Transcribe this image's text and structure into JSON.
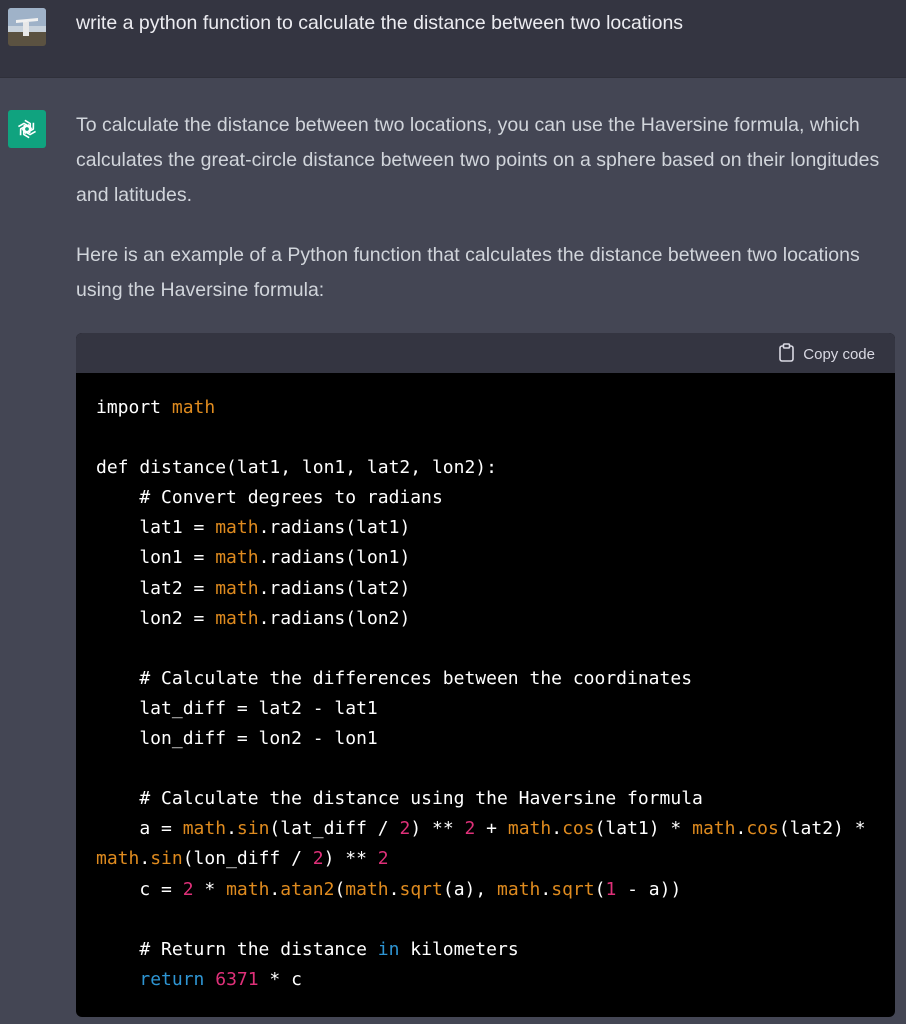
{
  "user_message": "write a python function to calculate the distance between two locations",
  "assistant": {
    "paragraph1": "To calculate the distance between two locations, you can use the Haversine formula, which calculates the great-circle distance between two points on a sphere based on their longitudes and latitudes.",
    "paragraph2": "Here is an example of a Python function that calculates the distance between two locations using the Haversine formula:"
  },
  "code_block": {
    "copy_label": "Copy code",
    "lines": [
      [
        [
          "plain",
          "import "
        ],
        [
          "math",
          "math"
        ]
      ],
      [],
      [
        [
          "plain",
          "def distance(lat1, lon1, lat2, lon2):"
        ]
      ],
      [
        [
          "plain",
          "    # Convert degrees to radians"
        ]
      ],
      [
        [
          "plain",
          "    lat1 = "
        ],
        [
          "math",
          "math"
        ],
        [
          "plain",
          ".radians(lat1)"
        ]
      ],
      [
        [
          "plain",
          "    lon1 = "
        ],
        [
          "math",
          "math"
        ],
        [
          "plain",
          ".radians(lon1)"
        ]
      ],
      [
        [
          "plain",
          "    lat2 = "
        ],
        [
          "math",
          "math"
        ],
        [
          "plain",
          ".radians(lat2)"
        ]
      ],
      [
        [
          "plain",
          "    lon2 = "
        ],
        [
          "math",
          "math"
        ],
        [
          "plain",
          ".radians(lon2)"
        ]
      ],
      [],
      [
        [
          "plain",
          "    # Calculate the differences between the coordinates"
        ]
      ],
      [
        [
          "plain",
          "    lat_diff = lat2 - lat1"
        ]
      ],
      [
        [
          "plain",
          "    lon_diff = lon2 - lon1"
        ]
      ],
      [],
      [
        [
          "plain",
          "    # Calculate the distance using the Haversine formula"
        ]
      ],
      [
        [
          "plain",
          "    a = "
        ],
        [
          "math",
          "math"
        ],
        [
          "plain",
          "."
        ],
        [
          "math",
          "sin"
        ],
        [
          "plain",
          "(lat_diff / "
        ],
        [
          "num",
          "2"
        ],
        [
          "plain",
          ") ** "
        ],
        [
          "num",
          "2"
        ],
        [
          "plain",
          " + "
        ],
        [
          "math",
          "math"
        ],
        [
          "plain",
          "."
        ],
        [
          "math",
          "cos"
        ],
        [
          "plain",
          "(lat1) * "
        ],
        [
          "math",
          "math"
        ],
        [
          "plain",
          "."
        ],
        [
          "math",
          "cos"
        ],
        [
          "plain",
          "(lat2) *"
        ]
      ],
      [
        [
          "math",
          "math"
        ],
        [
          "plain",
          "."
        ],
        [
          "math",
          "sin"
        ],
        [
          "plain",
          "(lon_diff / "
        ],
        [
          "num",
          "2"
        ],
        [
          "plain",
          ") ** "
        ],
        [
          "num",
          "2"
        ]
      ],
      [
        [
          "plain",
          "    c = "
        ],
        [
          "num",
          "2"
        ],
        [
          "plain",
          " * "
        ],
        [
          "math",
          "math"
        ],
        [
          "plain",
          "."
        ],
        [
          "math",
          "atan2"
        ],
        [
          "plain",
          "("
        ],
        [
          "math",
          "math"
        ],
        [
          "plain",
          "."
        ],
        [
          "math",
          "sqrt"
        ],
        [
          "plain",
          "(a), "
        ],
        [
          "math",
          "math"
        ],
        [
          "plain",
          "."
        ],
        [
          "math",
          "sqrt"
        ],
        [
          "plain",
          "("
        ],
        [
          "num",
          "1"
        ],
        [
          "plain",
          " - a))"
        ]
      ],
      [],
      [
        [
          "plain",
          "    # Return the distance "
        ],
        [
          "kw",
          "in"
        ],
        [
          "plain",
          " kilometers"
        ]
      ],
      [
        [
          "plain",
          "    "
        ],
        [
          "kw",
          "return"
        ],
        [
          "plain",
          " "
        ],
        [
          "num",
          "6371"
        ],
        [
          "plain",
          " * c"
        ]
      ]
    ]
  },
  "colors": {
    "user_bg": "#343541",
    "assistant_bg": "#444654",
    "brand_green": "#10a37f",
    "code_bg": "#000000",
    "token_math": "#df8b1f",
    "token_number": "#df3079",
    "token_keyword": "#2e95d3"
  },
  "icons": {
    "bot": "openai-logo-icon",
    "copy": "clipboard-icon",
    "user": "user-avatar"
  }
}
